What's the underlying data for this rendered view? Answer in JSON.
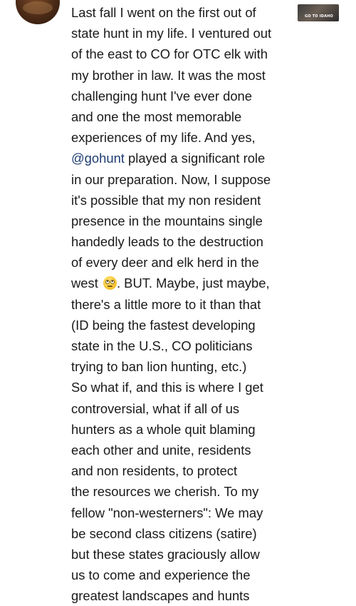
{
  "post": {
    "thumbnail_label": "GO TO IDAHO",
    "caption_lines": [
      "Last fall I went on the first out of",
      "state hunt in my life. I ventured out",
      "of the east to CO for OTC elk with",
      "my brother in law. It was the most",
      "challenging hunt I've ever done",
      "and one the most memorable",
      "experiences of my life. And yes,",
      "played a significant role",
      "in our preparation. Now, I suppose",
      "it's possible that my non resident",
      "presence in the mountains single",
      "handedly leads to the destruction",
      "of every deer and elk herd in the",
      "west",
      ". BUT. Maybe, just maybe,",
      "there's a little more to it than that",
      "(ID being the fastest developing",
      "state in the U.S., CO politicians",
      "trying to ban lion hunting, etc.)",
      "So what if, and this is where I get",
      "controversial, what if all of us",
      "hunters as a whole quit blaming",
      "each other and unite, residents",
      "and non residents, to protect",
      "the resources we cherish. To my",
      "fellow \"non-westerners\": We may",
      "be second class citizens (satire)",
      "but these states graciously allow",
      "us to come and experience the",
      "greatest landscapes and hunts"
    ],
    "mention": "@gohunt",
    "emoji_name": "face-with-rolling-eyes-emoji",
    "colors": {
      "mention": "#1e3d73",
      "text": "#1a1a1a",
      "background": "#ffffff"
    }
  }
}
